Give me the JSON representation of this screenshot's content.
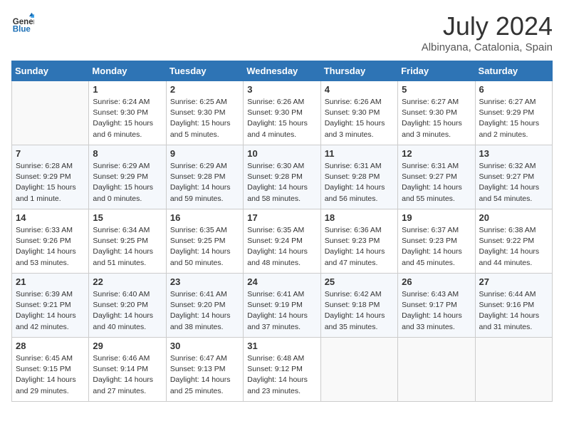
{
  "logo": {
    "text_general": "General",
    "text_blue": "Blue"
  },
  "header": {
    "month": "July 2024",
    "location": "Albinyana, Catalonia, Spain"
  },
  "weekdays": [
    "Sunday",
    "Monday",
    "Tuesday",
    "Wednesday",
    "Thursday",
    "Friday",
    "Saturday"
  ],
  "weeks": [
    [
      {
        "day": "",
        "sunrise": "",
        "sunset": "",
        "daylight": ""
      },
      {
        "day": "1",
        "sunrise": "Sunrise: 6:24 AM",
        "sunset": "Sunset: 9:30 PM",
        "daylight": "Daylight: 15 hours and 6 minutes."
      },
      {
        "day": "2",
        "sunrise": "Sunrise: 6:25 AM",
        "sunset": "Sunset: 9:30 PM",
        "daylight": "Daylight: 15 hours and 5 minutes."
      },
      {
        "day": "3",
        "sunrise": "Sunrise: 6:26 AM",
        "sunset": "Sunset: 9:30 PM",
        "daylight": "Daylight: 15 hours and 4 minutes."
      },
      {
        "day": "4",
        "sunrise": "Sunrise: 6:26 AM",
        "sunset": "Sunset: 9:30 PM",
        "daylight": "Daylight: 15 hours and 3 minutes."
      },
      {
        "day": "5",
        "sunrise": "Sunrise: 6:27 AM",
        "sunset": "Sunset: 9:30 PM",
        "daylight": "Daylight: 15 hours and 3 minutes."
      },
      {
        "day": "6",
        "sunrise": "Sunrise: 6:27 AM",
        "sunset": "Sunset: 9:29 PM",
        "daylight": "Daylight: 15 hours and 2 minutes."
      }
    ],
    [
      {
        "day": "7",
        "sunrise": "Sunrise: 6:28 AM",
        "sunset": "Sunset: 9:29 PM",
        "daylight": "Daylight: 15 hours and 1 minute."
      },
      {
        "day": "8",
        "sunrise": "Sunrise: 6:29 AM",
        "sunset": "Sunset: 9:29 PM",
        "daylight": "Daylight: 15 hours and 0 minutes."
      },
      {
        "day": "9",
        "sunrise": "Sunrise: 6:29 AM",
        "sunset": "Sunset: 9:28 PM",
        "daylight": "Daylight: 14 hours and 59 minutes."
      },
      {
        "day": "10",
        "sunrise": "Sunrise: 6:30 AM",
        "sunset": "Sunset: 9:28 PM",
        "daylight": "Daylight: 14 hours and 58 minutes."
      },
      {
        "day": "11",
        "sunrise": "Sunrise: 6:31 AM",
        "sunset": "Sunset: 9:28 PM",
        "daylight": "Daylight: 14 hours and 56 minutes."
      },
      {
        "day": "12",
        "sunrise": "Sunrise: 6:31 AM",
        "sunset": "Sunset: 9:27 PM",
        "daylight": "Daylight: 14 hours and 55 minutes."
      },
      {
        "day": "13",
        "sunrise": "Sunrise: 6:32 AM",
        "sunset": "Sunset: 9:27 PM",
        "daylight": "Daylight: 14 hours and 54 minutes."
      }
    ],
    [
      {
        "day": "14",
        "sunrise": "Sunrise: 6:33 AM",
        "sunset": "Sunset: 9:26 PM",
        "daylight": "Daylight: 14 hours and 53 minutes."
      },
      {
        "day": "15",
        "sunrise": "Sunrise: 6:34 AM",
        "sunset": "Sunset: 9:25 PM",
        "daylight": "Daylight: 14 hours and 51 minutes."
      },
      {
        "day": "16",
        "sunrise": "Sunrise: 6:35 AM",
        "sunset": "Sunset: 9:25 PM",
        "daylight": "Daylight: 14 hours and 50 minutes."
      },
      {
        "day": "17",
        "sunrise": "Sunrise: 6:35 AM",
        "sunset": "Sunset: 9:24 PM",
        "daylight": "Daylight: 14 hours and 48 minutes."
      },
      {
        "day": "18",
        "sunrise": "Sunrise: 6:36 AM",
        "sunset": "Sunset: 9:23 PM",
        "daylight": "Daylight: 14 hours and 47 minutes."
      },
      {
        "day": "19",
        "sunrise": "Sunrise: 6:37 AM",
        "sunset": "Sunset: 9:23 PM",
        "daylight": "Daylight: 14 hours and 45 minutes."
      },
      {
        "day": "20",
        "sunrise": "Sunrise: 6:38 AM",
        "sunset": "Sunset: 9:22 PM",
        "daylight": "Daylight: 14 hours and 44 minutes."
      }
    ],
    [
      {
        "day": "21",
        "sunrise": "Sunrise: 6:39 AM",
        "sunset": "Sunset: 9:21 PM",
        "daylight": "Daylight: 14 hours and 42 minutes."
      },
      {
        "day": "22",
        "sunrise": "Sunrise: 6:40 AM",
        "sunset": "Sunset: 9:20 PM",
        "daylight": "Daylight: 14 hours and 40 minutes."
      },
      {
        "day": "23",
        "sunrise": "Sunrise: 6:41 AM",
        "sunset": "Sunset: 9:20 PM",
        "daylight": "Daylight: 14 hours and 38 minutes."
      },
      {
        "day": "24",
        "sunrise": "Sunrise: 6:41 AM",
        "sunset": "Sunset: 9:19 PM",
        "daylight": "Daylight: 14 hours and 37 minutes."
      },
      {
        "day": "25",
        "sunrise": "Sunrise: 6:42 AM",
        "sunset": "Sunset: 9:18 PM",
        "daylight": "Daylight: 14 hours and 35 minutes."
      },
      {
        "day": "26",
        "sunrise": "Sunrise: 6:43 AM",
        "sunset": "Sunset: 9:17 PM",
        "daylight": "Daylight: 14 hours and 33 minutes."
      },
      {
        "day": "27",
        "sunrise": "Sunrise: 6:44 AM",
        "sunset": "Sunset: 9:16 PM",
        "daylight": "Daylight: 14 hours and 31 minutes."
      }
    ],
    [
      {
        "day": "28",
        "sunrise": "Sunrise: 6:45 AM",
        "sunset": "Sunset: 9:15 PM",
        "daylight": "Daylight: 14 hours and 29 minutes."
      },
      {
        "day": "29",
        "sunrise": "Sunrise: 6:46 AM",
        "sunset": "Sunset: 9:14 PM",
        "daylight": "Daylight: 14 hours and 27 minutes."
      },
      {
        "day": "30",
        "sunrise": "Sunrise: 6:47 AM",
        "sunset": "Sunset: 9:13 PM",
        "daylight": "Daylight: 14 hours and 25 minutes."
      },
      {
        "day": "31",
        "sunrise": "Sunrise: 6:48 AM",
        "sunset": "Sunset: 9:12 PM",
        "daylight": "Daylight: 14 hours and 23 minutes."
      },
      {
        "day": "",
        "sunrise": "",
        "sunset": "",
        "daylight": ""
      },
      {
        "day": "",
        "sunrise": "",
        "sunset": "",
        "daylight": ""
      },
      {
        "day": "",
        "sunrise": "",
        "sunset": "",
        "daylight": ""
      }
    ]
  ]
}
